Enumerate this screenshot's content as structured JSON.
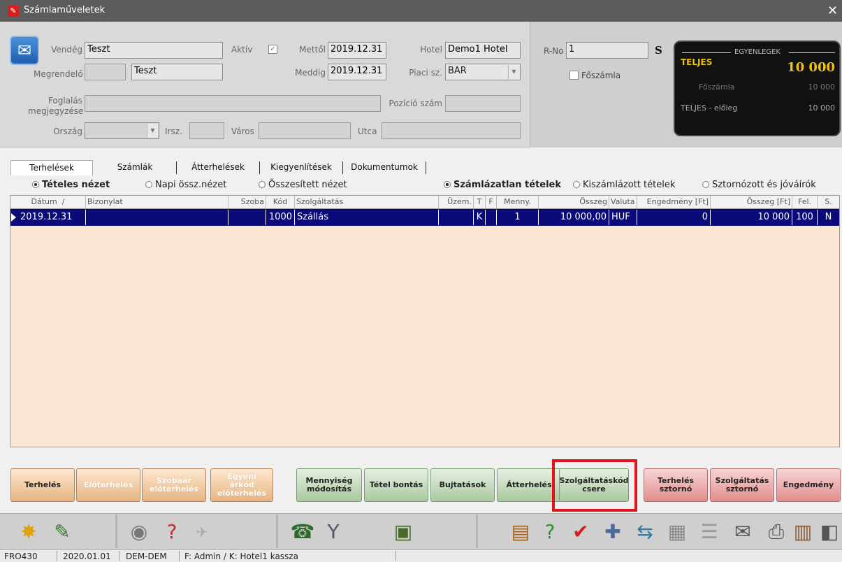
{
  "window": {
    "title": "Számlaműveletek",
    "close": "✕"
  },
  "header": {
    "guest_label": "Vendég",
    "guest_value": "Teszt",
    "orderer_label": "Megrendelő",
    "orderer_code": "",
    "orderer_name": "Teszt",
    "active_label": "Aktív",
    "active_checked": "✓",
    "from_label": "Mettől",
    "from_value": "2019.12.31",
    "to_label": "Meddig",
    "to_value": "2019.12.31",
    "hotel_label": "Hotel",
    "hotel_value": "Demo1 Hotel",
    "market_label": "Piaci sz.",
    "market_value": "BAR",
    "booking_note_label_1": "Foglalás",
    "booking_note_label_2": "megjegyzése",
    "booking_note_value": "",
    "position_label": "Pozíció szám",
    "position_value": "",
    "country_label": "Ország",
    "country_value": "",
    "zip_label": "Irsz.",
    "zip_value": "",
    "city_label": "Város",
    "city_value": "",
    "street_label": "Utca",
    "street_value": ""
  },
  "right_panel": {
    "rno_label": "R-No",
    "rno_value": "1",
    "s_label": "S",
    "main_invoice_label": "Főszámla"
  },
  "balance": {
    "caption": "EGYENLEGEK",
    "total_label": "TELJES",
    "total_value": "10 000",
    "main_label": "Főszámla",
    "main_value": "10 000",
    "advance_label": "TELJES - előleg",
    "advance_value": "10 000"
  },
  "tabs": [
    "Terhelések",
    "Számlák",
    "Átterhelések",
    "Kiegyenlítések",
    "Dokumentumok"
  ],
  "views": {
    "detailed": "Tételes nézet",
    "daily": "Napi össz.nézet",
    "summary": "Összesített nézet",
    "uninvoiced": "Számlázatlan tételek",
    "invoiced": "Kiszámlázott tételek",
    "storno": "Sztornózott és jóváírók"
  },
  "grid": {
    "columns": [
      "Dátum",
      "Bizonylat",
      "Szoba",
      "Kód",
      "Szolgáltatás",
      "Üzem.",
      "T",
      "F",
      "Menny.",
      "Összeg",
      "Valuta",
      "Engedmény [Ft]",
      "Összeg [Ft]",
      "Fel.",
      "S."
    ],
    "sort_marker": "/",
    "row": {
      "date": "2019.12.31",
      "doc": "",
      "room": "",
      "code": "1000",
      "service": "Szállás",
      "unit": "",
      "t": "K",
      "f": "",
      "qty": "1",
      "amount": "10 000,00",
      "currency": "HUF",
      "discount": "0",
      "amount_ft": "10 000",
      "fel": "100",
      "s": "N"
    }
  },
  "buttons": {
    "terheles": "Terhelés",
    "eloterheles": "Előterhelés",
    "szobaar": "Szobaár előterhelés",
    "egyeni": "Egyéni árkód előterhelés",
    "mennyiseg": "Mennyiség módosítás",
    "tetel": "Tétel bontás",
    "bujtatasok": "Bujtatások",
    "atterheles": "Átterhelés",
    "szolgkod": "Szolgáltatáskód csere",
    "sztorno": "Terhelés sztornó",
    "szolgsztorno": "Szolgáltatás sztornó",
    "engedmeny": "Engedmény"
  },
  "status": {
    "code": "FRO430",
    "date": "2020.01.01",
    "dept": "DEM-DEM",
    "user": "F: Admin  /  K: Hotel1 kassza"
  }
}
